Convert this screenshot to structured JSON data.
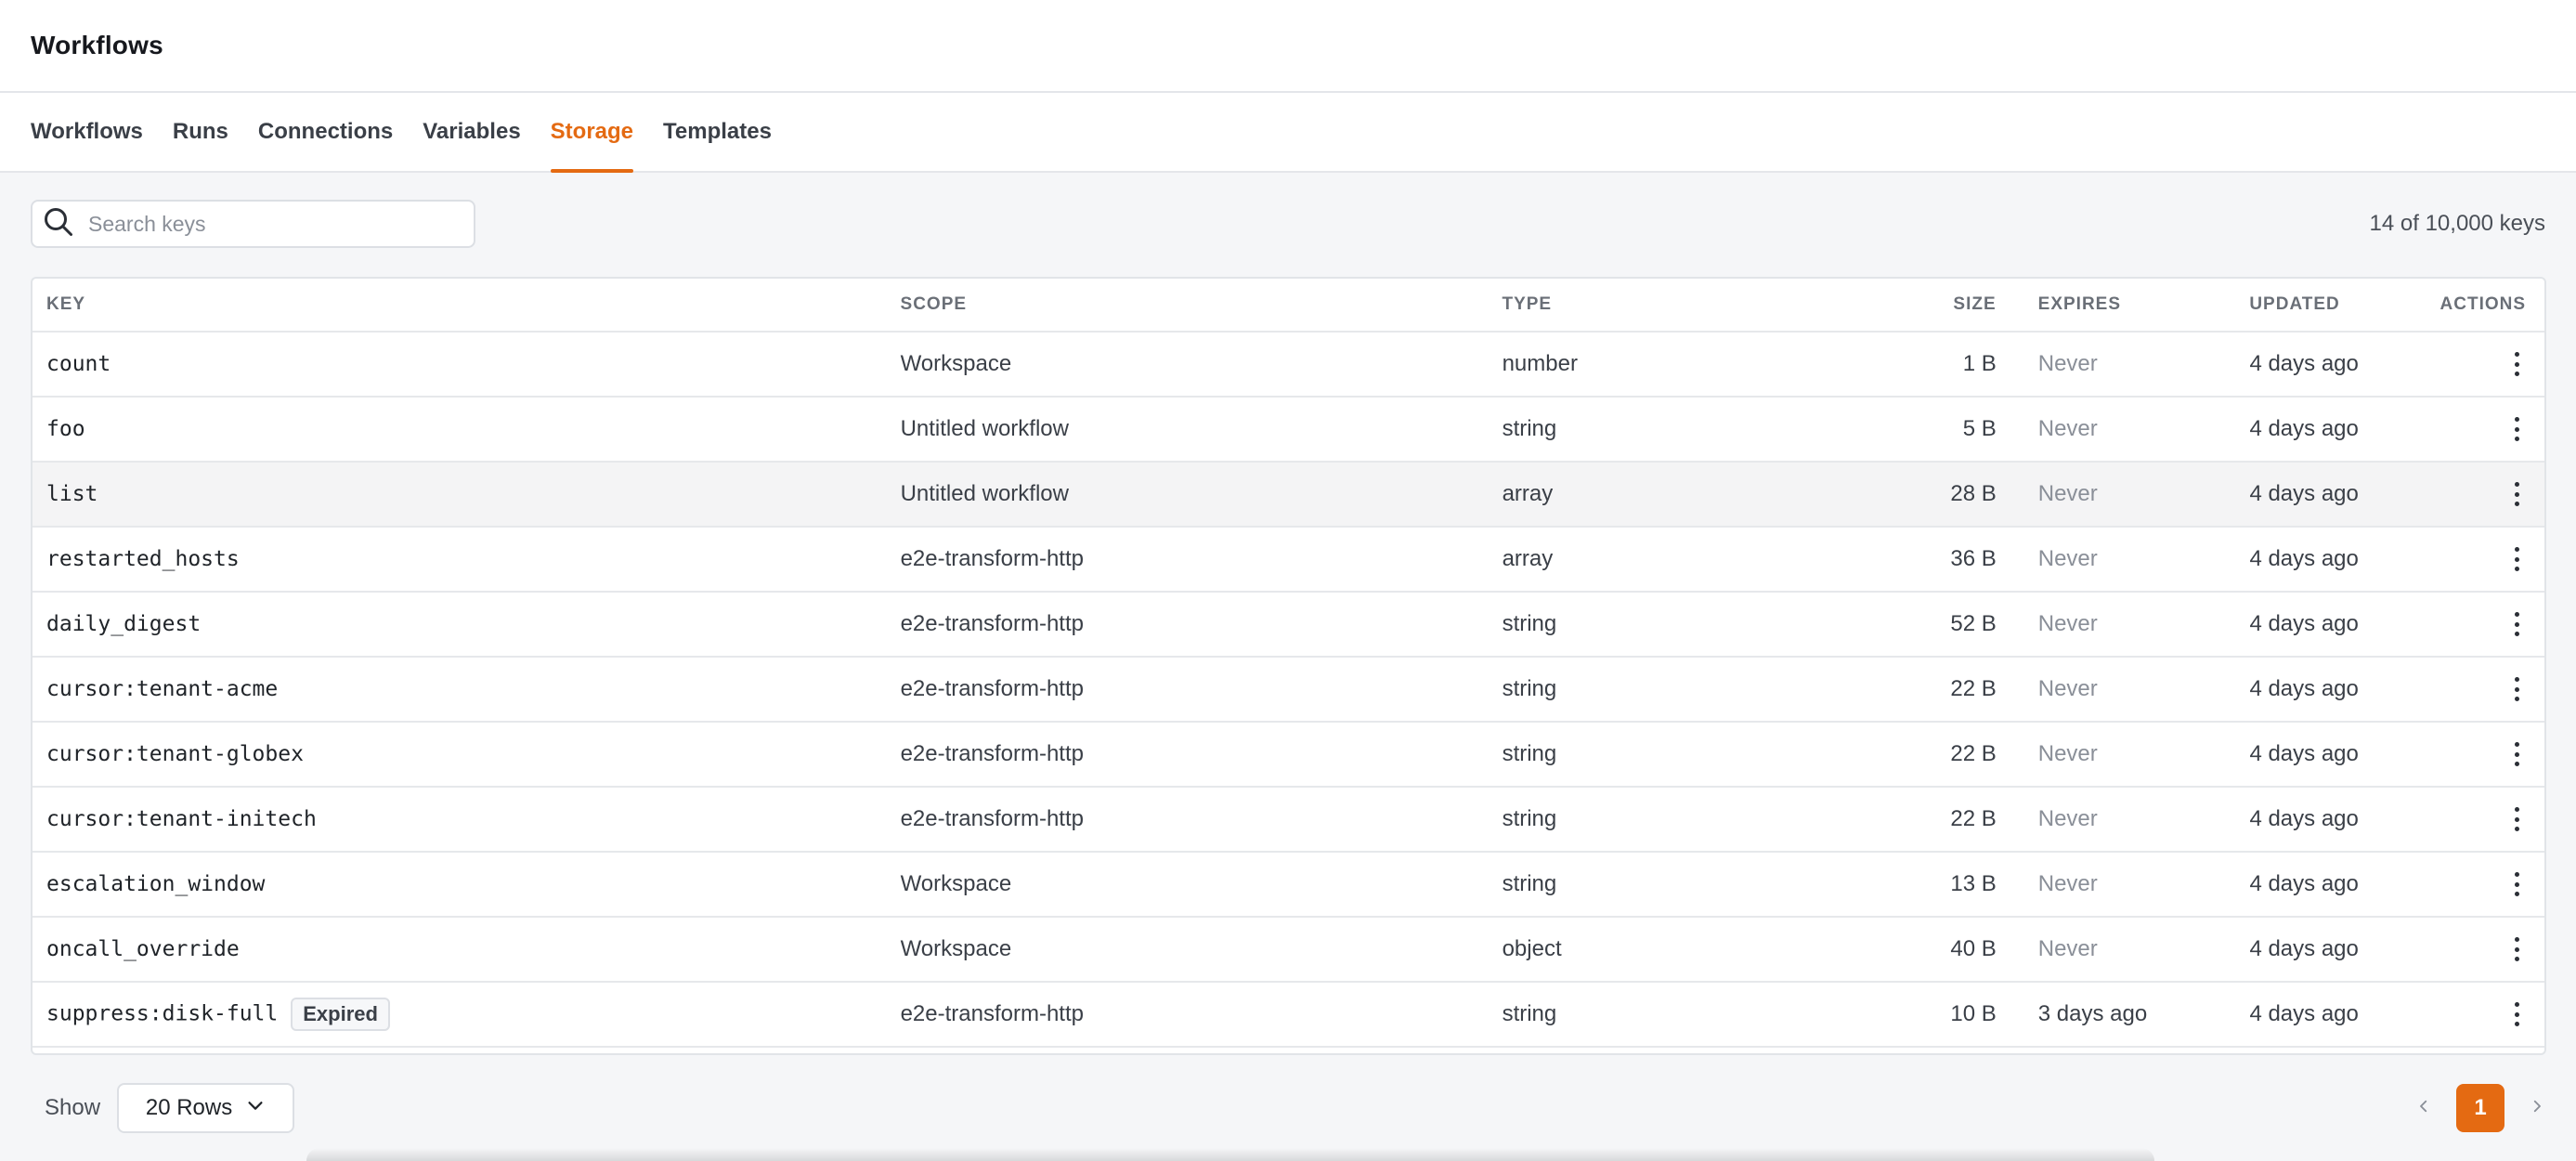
{
  "app": {
    "title": "Workflows"
  },
  "tabs": [
    {
      "label": "Workflows",
      "active": false
    },
    {
      "label": "Runs",
      "active": false
    },
    {
      "label": "Connections",
      "active": false
    },
    {
      "label": "Variables",
      "active": false
    },
    {
      "label": "Storage",
      "active": true
    },
    {
      "label": "Templates",
      "active": false
    }
  ],
  "search": {
    "placeholder": "Search keys",
    "value": "",
    "icon": "search-icon"
  },
  "summary": {
    "count_text": "14 of 10,000 keys"
  },
  "table": {
    "columns": [
      "KEY",
      "SCOPE",
      "TYPE",
      "SIZE",
      "EXPIRES",
      "UPDATED",
      "ACTIONS"
    ],
    "rows": [
      {
        "key": "count",
        "scope": "Workspace",
        "type": "number",
        "size": "1 B",
        "expires": "Never",
        "updated": "4 days ago"
      },
      {
        "key": "foo",
        "scope": "Untitled workflow",
        "type": "string",
        "size": "5 B",
        "expires": "Never",
        "updated": "4 days ago"
      },
      {
        "key": "list",
        "scope": "Untitled workflow",
        "type": "array",
        "size": "28 B",
        "expires": "Never",
        "updated": "4 days ago"
      },
      {
        "key": "restarted_hosts",
        "scope": "e2e-transform-http",
        "type": "array",
        "size": "36 B",
        "expires": "Never",
        "updated": "4 days ago"
      },
      {
        "key": "daily_digest",
        "scope": "e2e-transform-http",
        "type": "string",
        "size": "52 B",
        "expires": "Never",
        "updated": "4 days ago"
      },
      {
        "key": "cursor:tenant-acme",
        "scope": "e2e-transform-http",
        "type": "string",
        "size": "22 B",
        "expires": "Never",
        "updated": "4 days ago"
      },
      {
        "key": "cursor:tenant-globex",
        "scope": "e2e-transform-http",
        "type": "string",
        "size": "22 B",
        "expires": "Never",
        "updated": "4 days ago"
      },
      {
        "key": "cursor:tenant-initech",
        "scope": "e2e-transform-http",
        "type": "string",
        "size": "22 B",
        "expires": "Never",
        "updated": "4 days ago"
      },
      {
        "key": "escalation_window",
        "scope": "Workspace",
        "type": "string",
        "size": "13 B",
        "expires": "Never",
        "updated": "4 days ago"
      },
      {
        "key": "oncall_override",
        "scope": "Workspace",
        "type": "object",
        "size": "40 B",
        "expires": "Never",
        "updated": "4 days ago"
      },
      {
        "key": "suppress:disk-full",
        "badge": "Expired",
        "scope": "e2e-transform-http",
        "type": "string",
        "size": "10 B",
        "expires": "3 days ago",
        "updated": "4 days ago"
      }
    ]
  },
  "footer": {
    "show_label": "Show",
    "rows_option": "20 Rows",
    "current_page": "1"
  },
  "colors": {
    "accent": "#e46a12",
    "background": "#f5f6f8"
  }
}
